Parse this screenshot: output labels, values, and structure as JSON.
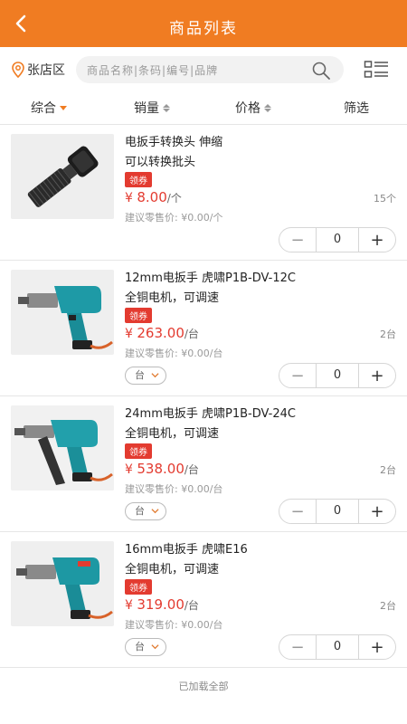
{
  "header": {
    "title": "商品列表"
  },
  "search": {
    "location": "张店区",
    "placeholder": "商品名称|条码|编号|品牌"
  },
  "sort": {
    "items": [
      "综合",
      "销量",
      "价格",
      "筛选"
    ]
  },
  "products": [
    {
      "name": "电扳手转换头 伸缩\n可以转换批头",
      "coupon": "领券",
      "price_symbol": "¥",
      "price": "8.00",
      "unit": "/个",
      "stock": "15个",
      "retail": "建议零售价: ¥0.00/个",
      "quantity": "0"
    },
    {
      "name": "12mm电扳手 虎啸P1B-DV-12C\n全铜电机，可调速",
      "coupon": "领券",
      "price_symbol": "¥",
      "price": "263.00",
      "unit": "/台",
      "stock": "2台",
      "retail": "建议零售价: ¥0.00/台",
      "unit_select": "台",
      "quantity": "0"
    },
    {
      "name": "24mm电扳手 虎啸P1B-DV-24C\n全铜电机，可调速",
      "coupon": "领券",
      "price_symbol": "¥",
      "price": "538.00",
      "unit": "/台",
      "stock": "2台",
      "retail": "建议零售价: ¥0.00/台",
      "unit_select": "台",
      "quantity": "0"
    },
    {
      "name": "16mm电扳手 虎啸E16\n全铜电机，可调速",
      "coupon": "领券",
      "price_symbol": "¥",
      "price": "319.00",
      "unit": "/台",
      "stock": "2台",
      "retail": "建议零售价: ¥0.00/台",
      "unit_select": "台",
      "quantity": "0"
    }
  ],
  "footer": {
    "text": "已加载全部"
  },
  "colors": {
    "brand": "#f07c22",
    "price": "#e33b30",
    "coupon_bg": "#e33b30"
  }
}
